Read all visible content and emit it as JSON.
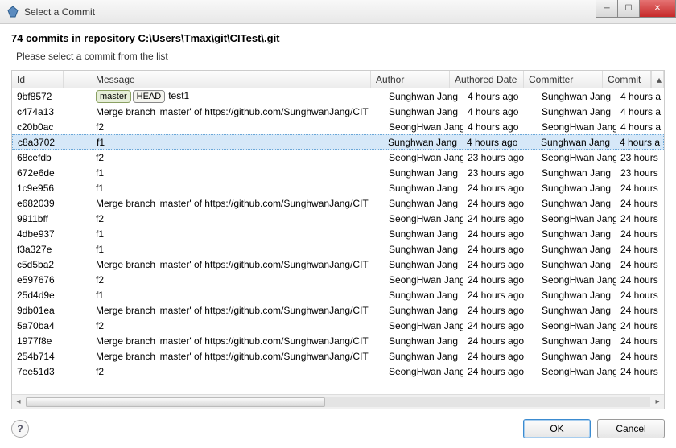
{
  "window": {
    "title": "Select a Commit"
  },
  "header": {
    "title": "74 commits in repository C:\\Users\\Tmax\\git\\CITest\\.git",
    "subtitle": "Please select a commit from the list"
  },
  "columns": {
    "id": "Id",
    "message": "Message",
    "author": "Author",
    "authored_date": "Authored Date",
    "committer": "Committer",
    "commit_date": "Commit"
  },
  "tags": {
    "master": "master",
    "head": "HEAD"
  },
  "selected_id": "c8a3702",
  "rows": [
    {
      "id": "9bf8572",
      "msg": "test1",
      "tags": [
        "master",
        "head"
      ],
      "author": "Sunghwan Jang",
      "adate": "4 hours ago",
      "committer": "Sunghwan Jang",
      "cdate": "4 hours a"
    },
    {
      "id": "c474a13",
      "msg": "Merge branch 'master' of https://github.com/SunghwanJang/CIT",
      "author": "Sunghwan Jang",
      "adate": "4 hours ago",
      "committer": "Sunghwan Jang",
      "cdate": "4 hours a"
    },
    {
      "id": "c20b0ac",
      "msg": "f2",
      "author": "SeongHwan Jang",
      "adate": "4 hours ago",
      "committer": "SeongHwan Jang",
      "cdate": "4 hours a"
    },
    {
      "id": "c8a3702",
      "msg": "f1",
      "author": "Sunghwan Jang",
      "adate": "4 hours ago",
      "committer": "Sunghwan Jang",
      "cdate": "4 hours a"
    },
    {
      "id": "68cefdb",
      "msg": "f2",
      "author": "SeongHwan Jang",
      "adate": "23 hours ago",
      "committer": "SeongHwan Jang",
      "cdate": "23 hours"
    },
    {
      "id": "672e6de",
      "msg": "f1",
      "author": "Sunghwan Jang",
      "adate": "23 hours ago",
      "committer": "Sunghwan Jang",
      "cdate": "23 hours"
    },
    {
      "id": "1c9e956",
      "msg": "f1",
      "author": "Sunghwan Jang",
      "adate": "24 hours ago",
      "committer": "Sunghwan Jang",
      "cdate": "24 hours"
    },
    {
      "id": "e682039",
      "msg": "Merge branch 'master' of https://github.com/SunghwanJang/CIT",
      "author": "Sunghwan Jang",
      "adate": "24 hours ago",
      "committer": "Sunghwan Jang",
      "cdate": "24 hours"
    },
    {
      "id": "9911bff",
      "msg": "f2",
      "author": "SeongHwan Jang",
      "adate": "24 hours ago",
      "committer": "SeongHwan Jang",
      "cdate": "24 hours"
    },
    {
      "id": "4dbe937",
      "msg": "f1",
      "author": "Sunghwan Jang",
      "adate": "24 hours ago",
      "committer": "Sunghwan Jang",
      "cdate": "24 hours"
    },
    {
      "id": "f3a327e",
      "msg": "f1",
      "author": "Sunghwan Jang",
      "adate": "24 hours ago",
      "committer": "Sunghwan Jang",
      "cdate": "24 hours"
    },
    {
      "id": "c5d5ba2",
      "msg": "Merge branch 'master' of https://github.com/SunghwanJang/CIT",
      "author": "Sunghwan Jang",
      "adate": "24 hours ago",
      "committer": "Sunghwan Jang",
      "cdate": "24 hours"
    },
    {
      "id": "e597676",
      "msg": "f2",
      "author": "SeongHwan Jang",
      "adate": "24 hours ago",
      "committer": "SeongHwan Jang",
      "cdate": "24 hours"
    },
    {
      "id": "25d4d9e",
      "msg": "f1",
      "author": "Sunghwan Jang",
      "adate": "24 hours ago",
      "committer": "Sunghwan Jang",
      "cdate": "24 hours"
    },
    {
      "id": "9db01ea",
      "msg": "Merge branch 'master' of https://github.com/SunghwanJang/CIT",
      "author": "Sunghwan Jang",
      "adate": "24 hours ago",
      "committer": "Sunghwan Jang",
      "cdate": "24 hours"
    },
    {
      "id": "5a70ba4",
      "msg": "f2",
      "author": "SeongHwan Jang",
      "adate": "24 hours ago",
      "committer": "SeongHwan Jang",
      "cdate": "24 hours"
    },
    {
      "id": "1977f8e",
      "msg": "Merge branch 'master' of https://github.com/SunghwanJang/CIT",
      "author": "Sunghwan Jang",
      "adate": "24 hours ago",
      "committer": "Sunghwan Jang",
      "cdate": "24 hours"
    },
    {
      "id": "254b714",
      "msg": "Merge branch 'master' of https://github.com/SunghwanJang/CIT",
      "author": "Sunghwan Jang",
      "adate": "24 hours ago",
      "committer": "Sunghwan Jang",
      "cdate": "24 hours"
    },
    {
      "id": "7ee51d3",
      "msg": "f2",
      "author": "SeongHwan Jang",
      "adate": "24 hours ago",
      "committer": "SeongHwan Jang",
      "cdate": "24 hours"
    }
  ],
  "buttons": {
    "ok": "OK",
    "cancel": "Cancel"
  }
}
